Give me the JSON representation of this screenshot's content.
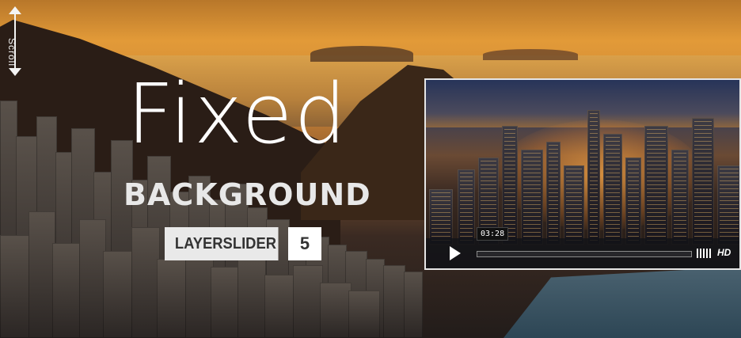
{
  "scroll_hint": {
    "label": "Scroll"
  },
  "headline": {
    "line1": "Fixed",
    "line2": "BACKGROUND"
  },
  "badge": {
    "name": "LAYERSLIDER",
    "version": "5"
  },
  "video": {
    "time": "03:28",
    "progress": 0.0,
    "quality_label": "HD",
    "play_icon": "play-icon",
    "volume_icon": "volume-bars-icon"
  },
  "colors": {
    "sunset": "#e29a38",
    "text_light": "#ffffff",
    "badge_bg": "#e9e9e9",
    "player_border": "#e6e6e6"
  }
}
